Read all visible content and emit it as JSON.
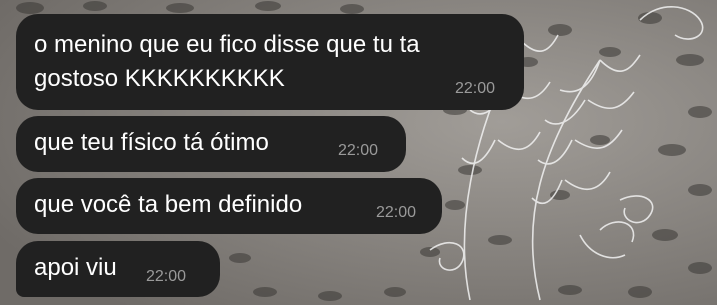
{
  "chat": {
    "messages": [
      {
        "text": "o menino que eu fico disse que tu ta\ngostoso KKKKKKKKKK",
        "time": "22:00"
      },
      {
        "text": "que teu físico tá ótimo",
        "time": "22:00"
      },
      {
        "text": "que você ta bem definido",
        "time": "22:00"
      },
      {
        "text": "apoi viu",
        "time": "22:00"
      }
    ]
  },
  "colors": {
    "bubble": "#212121",
    "message_text": "#ffffff",
    "timestamp": "#9a9a9a",
    "wallpaper": "#8d8a86"
  },
  "wallpaper": {
    "icon": "feather-pattern-wallpaper"
  }
}
